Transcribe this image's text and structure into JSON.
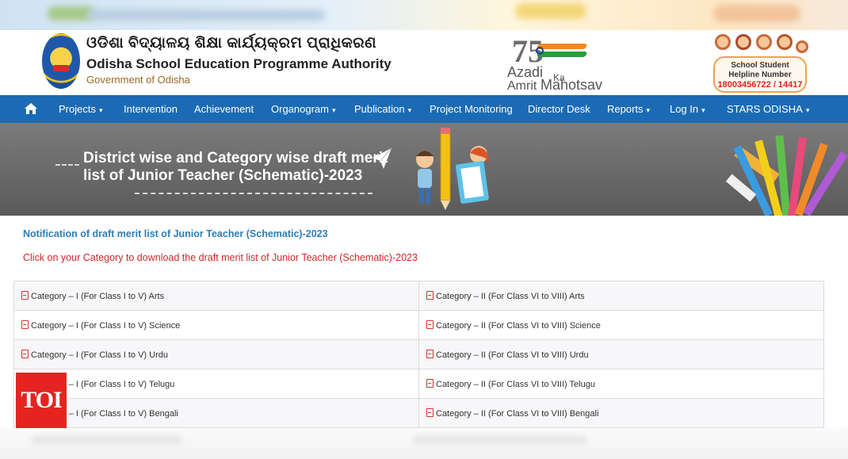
{
  "header": {
    "org_odia": "ଓଡିଶା ବିଦ୍ୟାଳୟ ଶିକ୍ଷା କାର୍ଯ୍ୟକ୍ରମ ପ୍ରାଧିକରଣ",
    "org_name": "Odisha School Education Programme Authority",
    "govt": "Government of Odisha",
    "azadi": {
      "number": "75",
      "line1": "Azadi",
      "ka": "Ka",
      "line2": "Amrit",
      "line3": "Mahotsav"
    },
    "helpline": {
      "line1": "School Student",
      "line2": "Helpline Number",
      "number": "18003456722 / 14417"
    }
  },
  "nav": {
    "items": [
      {
        "label": "Projects",
        "dropdown": true
      },
      {
        "label": "Intervention",
        "dropdown": false
      },
      {
        "label": "Achievement",
        "dropdown": false
      },
      {
        "label": "Organogram",
        "dropdown": true
      },
      {
        "label": "Publication",
        "dropdown": true
      },
      {
        "label": "Project Monitoring",
        "dropdown": false
      },
      {
        "label": "Director Desk",
        "dropdown": false
      },
      {
        "label": "Reports",
        "dropdown": true
      },
      {
        "label": "Log In",
        "dropdown": true
      },
      {
        "label": "STARS ODISHA",
        "dropdown": true
      }
    ]
  },
  "banner": {
    "title": "District wise and Category wise draft merit list of Junior Teacher (Schematic)-2023"
  },
  "content": {
    "notification": "Notification of draft merit list of Junior Teacher (Schematic)-2023",
    "instruction": "Click on your Category to download the draft merit list of Junior Teacher (Schematic)-2023",
    "rows": [
      {
        "left": "Category – I (For Class I to V) Arts",
        "right": "Category – II (For Class VI to VIII) Arts"
      },
      {
        "left": "Category – I (For Class I to V) Science",
        "right": "Category – II (For Class VI to VIII) Science"
      },
      {
        "left": "Category – I (For Class I to V) Urdu",
        "right": "Category – II (For Class VI to VIII) Urdu"
      },
      {
        "left": "Category – I (For Class I to V) Telugu",
        "right": "Category – II (For Class VI to VIII) Telugu"
      },
      {
        "left": "Category – I (For Class I to V) Bengali",
        "right": "Category – II (For Class VI to VIII) Bengali"
      }
    ]
  },
  "watermark": {
    "text": "TOI"
  },
  "colors": {
    "nav": "#1b6bb4",
    "notification": "#2d7db6",
    "instruction": "#d0262a",
    "pdf_icon": "#d6322c",
    "toi": "#e52421"
  },
  "icons": {
    "home": "home-icon",
    "pdf": "pdf-file-icon"
  }
}
